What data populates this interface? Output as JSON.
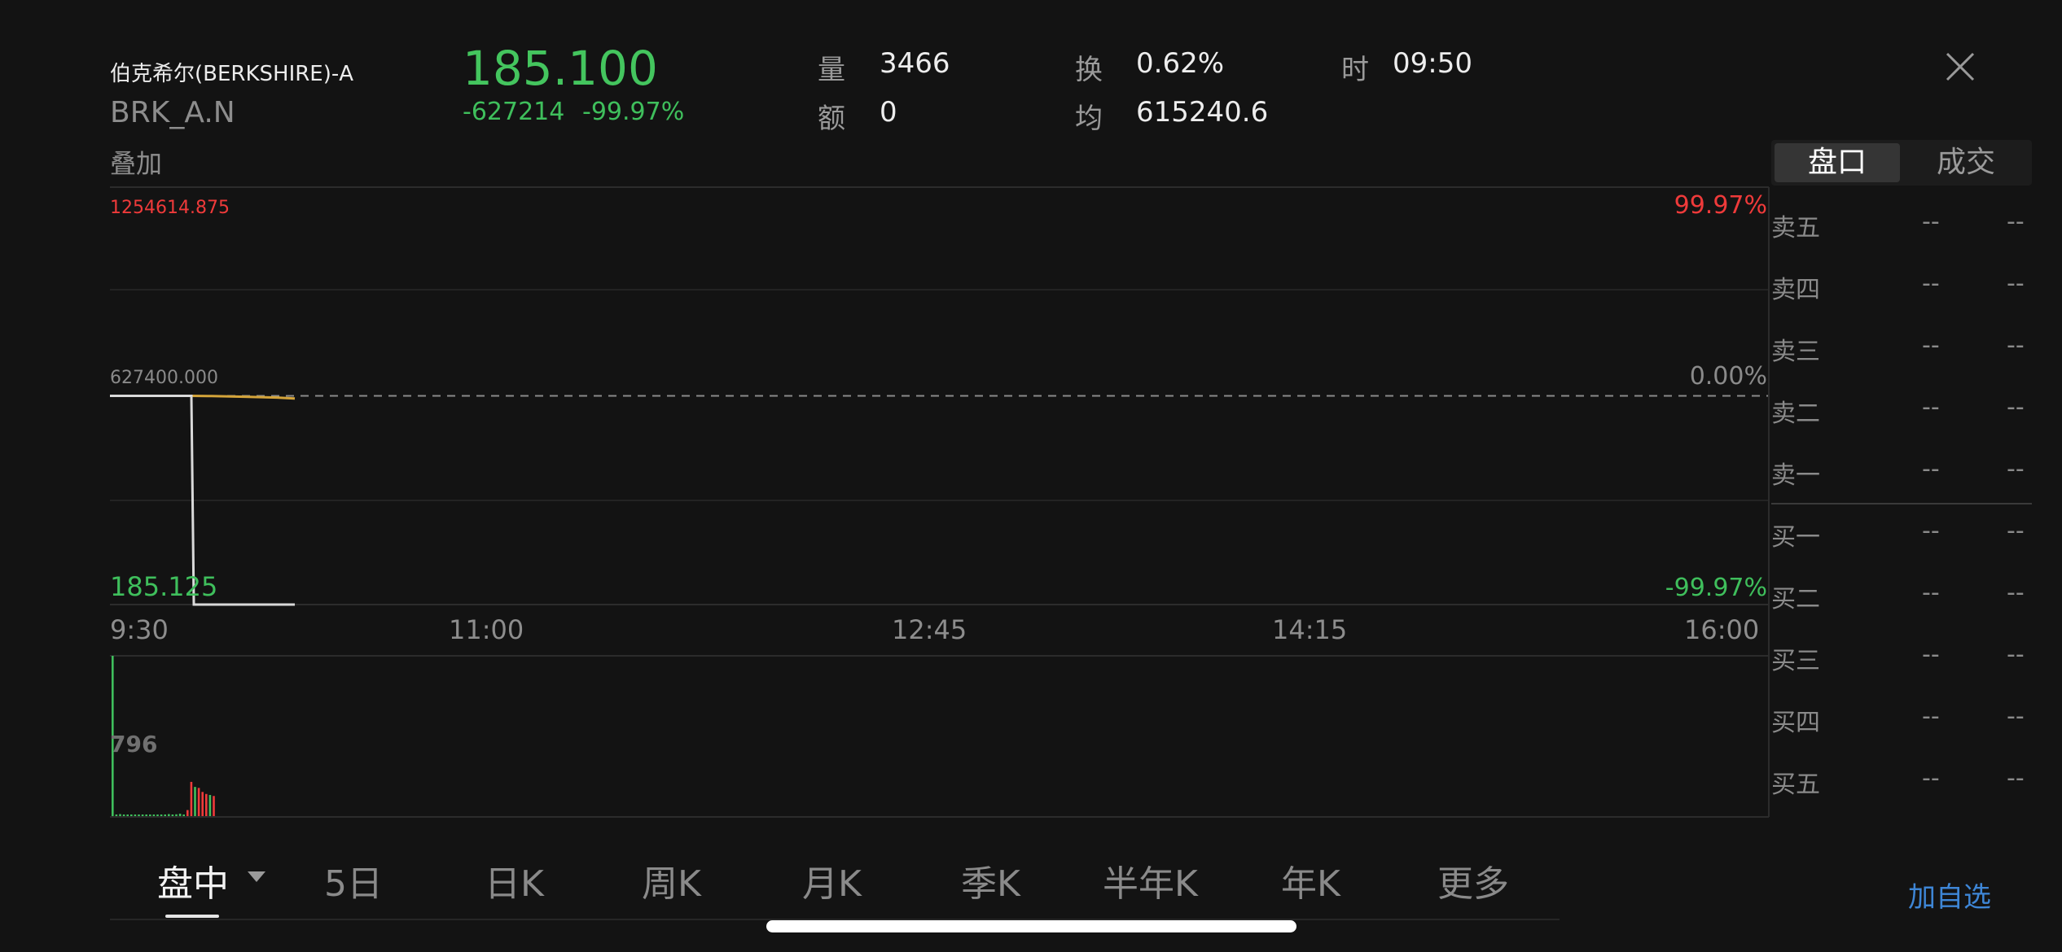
{
  "stock": {
    "title": "伯克希尔(BERKSHIRE)-A",
    "symbol": "BRK_A.N",
    "overlay_label": "叠加",
    "price": "185.100",
    "change": "-627214",
    "change_pct": "-99.97%"
  },
  "stats": [
    {
      "key": "量",
      "value": "3466"
    },
    {
      "key": "额",
      "value": "0"
    },
    {
      "key": "换",
      "value": "0.62%"
    },
    {
      "key": "均",
      "value": "615240.6"
    },
    {
      "key": "时",
      "value": "09:50"
    }
  ],
  "chart_data": {
    "type": "line",
    "x_ticks": [
      "9:30",
      "11:00",
      "12:45",
      "14:15",
      "16:00"
    ],
    "y_max_label": "1254614.875",
    "y_mid_label": "627400.000",
    "y_min_label": "185.125",
    "pct_max": "99.97%",
    "pct_mid": "0.00%",
    "pct_min": "-99.97%",
    "ylim": [
      185.125,
      1254614.875
    ],
    "reference_price": 627400.0,
    "series": [
      {
        "values": [
          627400,
          627400,
          627400,
          185.1,
          185.1,
          185.1,
          185.1
        ]
      },
      {
        "values": [
          627400,
          627400,
          627400,
          627350,
          627200,
          627000,
          626800
        ]
      }
    ],
    "volume_label": "796",
    "volume_max": 796,
    "volume": [
      {
        "v": 796,
        "c": "green"
      },
      {
        "v": 8,
        "c": "green"
      },
      {
        "v": 10,
        "c": "green"
      },
      {
        "v": 6,
        "c": "green"
      },
      {
        "v": 5,
        "c": "green"
      },
      {
        "v": 4,
        "c": "green"
      },
      {
        "v": 5,
        "c": "green"
      },
      {
        "v": 4,
        "c": "green"
      },
      {
        "v": 6,
        "c": "green"
      },
      {
        "v": 5,
        "c": "green"
      },
      {
        "v": 4,
        "c": "green"
      },
      {
        "v": 7,
        "c": "green"
      },
      {
        "v": 5,
        "c": "green"
      },
      {
        "v": 6,
        "c": "green"
      },
      {
        "v": 8,
        "c": "green"
      },
      {
        "v": 10,
        "c": "green"
      },
      {
        "v": 6,
        "c": "green"
      },
      {
        "v": 9,
        "c": "green"
      },
      {
        "v": 12,
        "c": "green"
      },
      {
        "v": 8,
        "c": "green"
      },
      {
        "v": 30,
        "c": "red"
      },
      {
        "v": 170,
        "c": "red"
      },
      {
        "v": 145,
        "c": "green"
      },
      {
        "v": 140,
        "c": "red"
      },
      {
        "v": 120,
        "c": "red"
      },
      {
        "v": 110,
        "c": "red"
      },
      {
        "v": 105,
        "c": "green"
      },
      {
        "v": 100,
        "c": "red"
      }
    ]
  },
  "order_book": {
    "tabs": [
      "盘口",
      "成交"
    ],
    "active_tab": 0,
    "asks": [
      {
        "label": "卖五",
        "price": "--",
        "vol": "--"
      },
      {
        "label": "卖四",
        "price": "--",
        "vol": "--"
      },
      {
        "label": "卖三",
        "price": "--",
        "vol": "--"
      },
      {
        "label": "卖二",
        "price": "--",
        "vol": "--"
      },
      {
        "label": "卖一",
        "price": "--",
        "vol": "--"
      }
    ],
    "bids": [
      {
        "label": "买一",
        "price": "--",
        "vol": "--"
      },
      {
        "label": "买二",
        "price": "--",
        "vol": "--"
      },
      {
        "label": "买三",
        "price": "--",
        "vol": "--"
      },
      {
        "label": "买四",
        "price": "--",
        "vol": "--"
      },
      {
        "label": "买五",
        "price": "--",
        "vol": "--"
      }
    ]
  },
  "periods": [
    "盘中",
    "5日",
    "日K",
    "周K",
    "月K",
    "季K",
    "半年K",
    "年K",
    "更多"
  ],
  "active_period": 0,
  "watchlist_label": "加自选",
  "colors": {
    "up": "#ef3a3a",
    "down": "#3fbf5c",
    "price_line": "#d9d9d9",
    "avg_line": "#d4a43a",
    "watch_blue": "#3e86d6"
  }
}
